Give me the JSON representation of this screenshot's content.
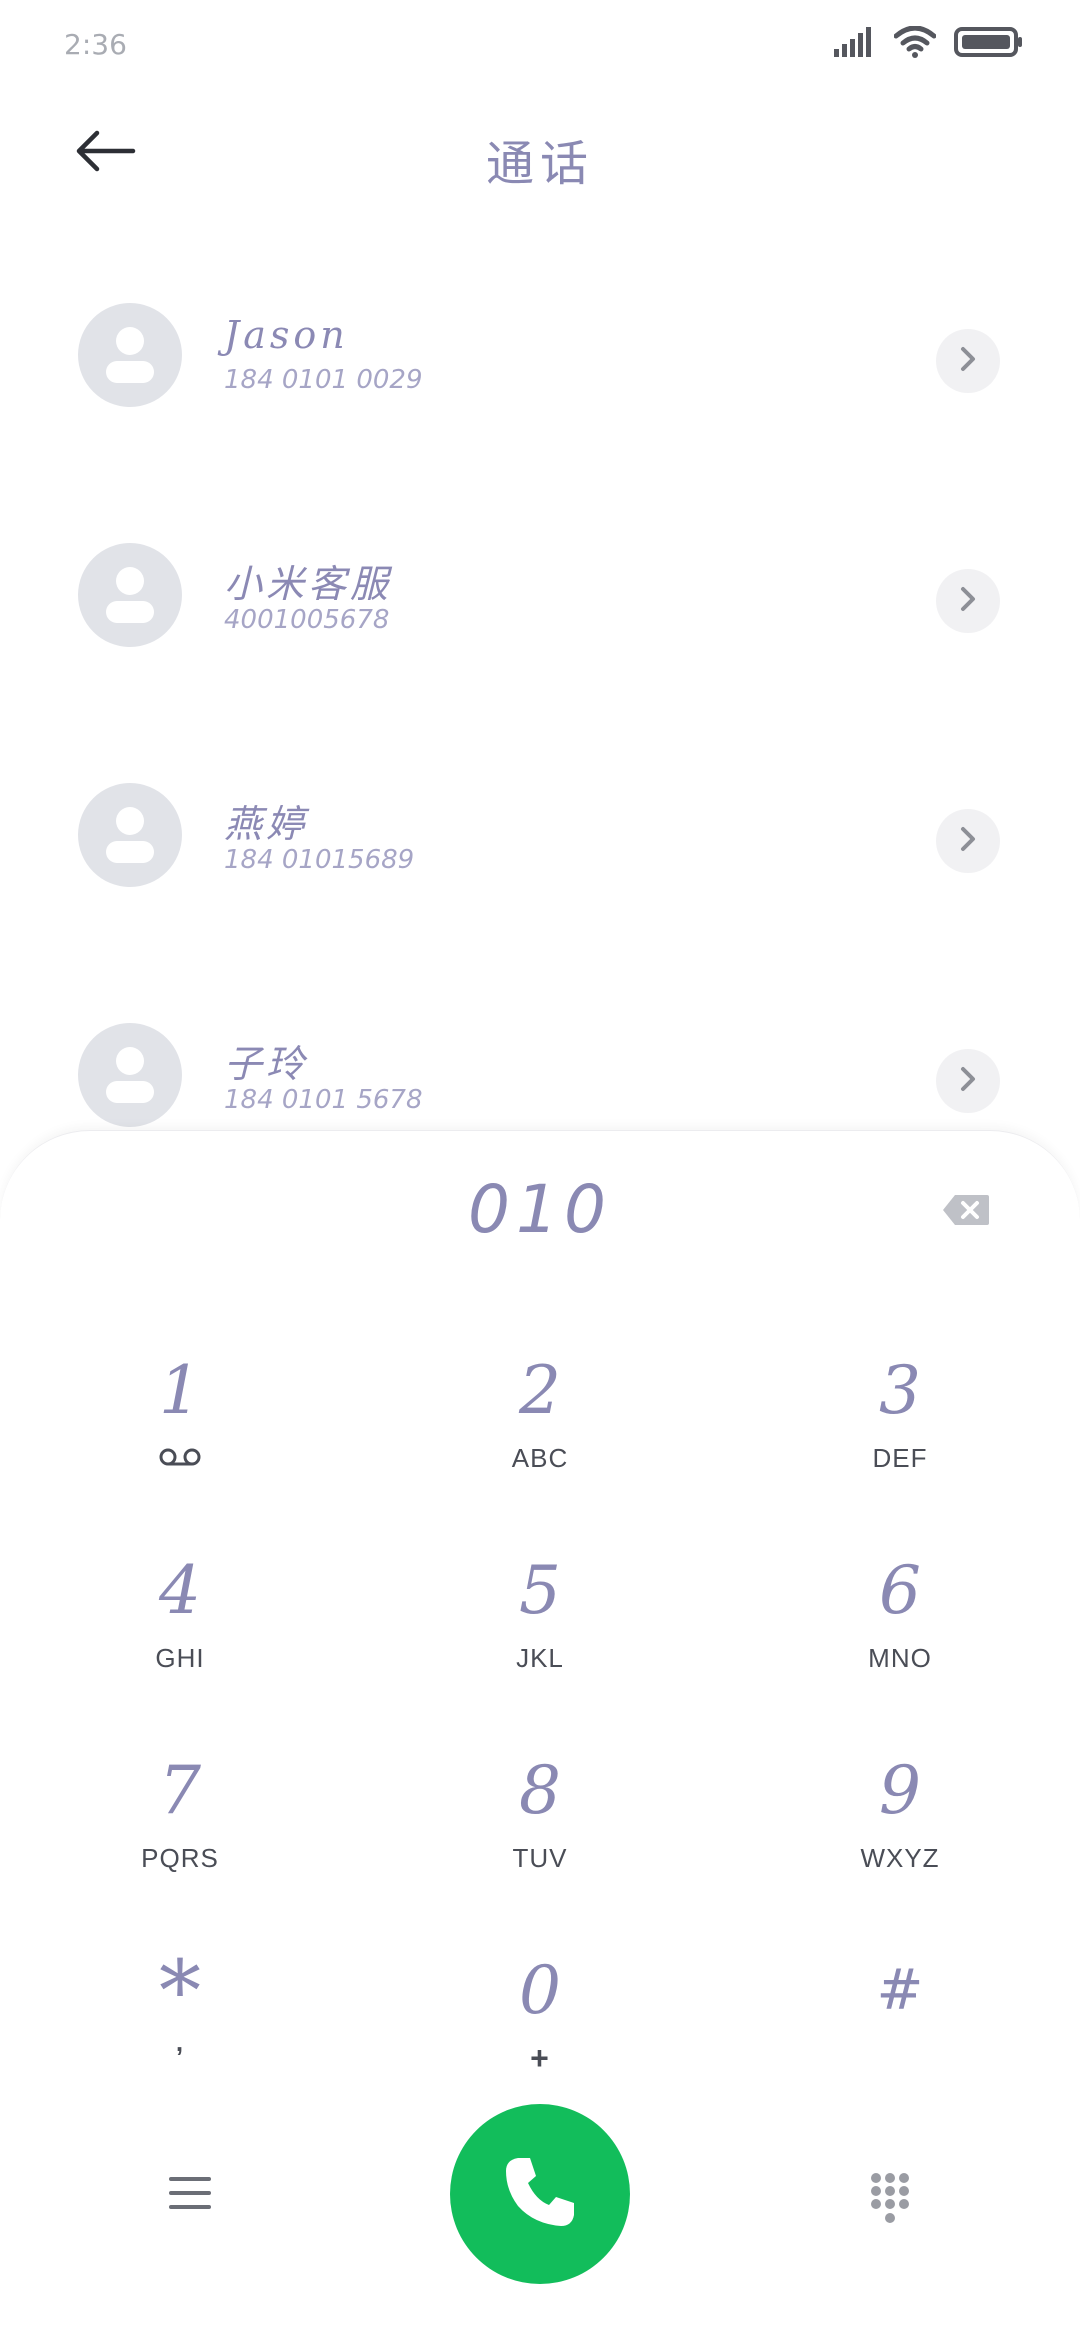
{
  "status_bar": {
    "time": "2:36",
    "icons": [
      "signal-icon",
      "wifi-icon",
      "battery-icon"
    ]
  },
  "header": {
    "back_icon": "arrow-left-icon",
    "title": "通话"
  },
  "contacts": [
    {
      "name": "Jason",
      "number": "184 0101 0029"
    },
    {
      "name": "小米客服",
      "number": "4001005678"
    },
    {
      "name": "燕婷",
      "number": "184 01015689"
    },
    {
      "name": "子玲",
      "number": "184 0101 5678"
    }
  ],
  "dialpad": {
    "input_value": "010",
    "backspace_icon": "backspace-icon",
    "keys": [
      {
        "digit": "1",
        "letters": "",
        "sub_icon": "voicemail-icon"
      },
      {
        "digit": "2",
        "letters": "ABC"
      },
      {
        "digit": "3",
        "letters": "DEF"
      },
      {
        "digit": "4",
        "letters": "GHI"
      },
      {
        "digit": "5",
        "letters": "JKL"
      },
      {
        "digit": "6",
        "letters": "MNO"
      },
      {
        "digit": "7",
        "letters": "PQRS"
      },
      {
        "digit": "8",
        "letters": "TUV"
      },
      {
        "digit": "9",
        "letters": "WXYZ"
      },
      {
        "digit": "*",
        "letters": ","
      },
      {
        "digit": "0",
        "letters": "+"
      },
      {
        "digit": "#",
        "letters": ""
      }
    ]
  },
  "bottom_bar": {
    "menu_icon": "menu-icon",
    "call_icon": "phone-icon",
    "keypad_icon": "dialpad-icon"
  },
  "colors": {
    "accent_text": "#8a89b3",
    "call_green": "#12bd5b",
    "avatar_bg": "#e1e3e8"
  }
}
